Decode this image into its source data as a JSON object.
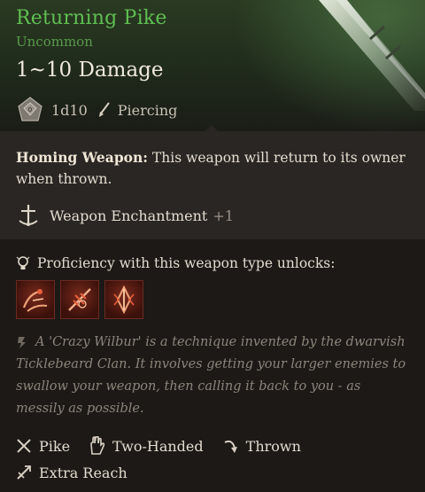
{
  "item": {
    "name": "Returning Pike",
    "rarity": "Uncommon",
    "damage": "1~10 Damage",
    "dice": "1d10",
    "damage_type": "Piercing"
  },
  "homing": {
    "title": "Homing Weapon:",
    "text": " This weapon will return to its owner when thrown."
  },
  "enchantment": {
    "label": "Weapon Enchantment",
    "value": "+1"
  },
  "proficiency": {
    "label": "Proficiency with this weapon type unlocks:",
    "actions": [
      "flourish-action-icon",
      "lacerate-action-icon",
      "pommel-strike-action-icon"
    ]
  },
  "lore": {
    "text": "A 'Crazy Wilbur' is a technique invented by the dwarvish Ticklebeard Clan. It involves getting your larger enemies to swallow your weapon, then calling it back to you - as messily as possible."
  },
  "tags": {
    "pike": "Pike",
    "two_handed": "Two-Handed",
    "thrown": "Thrown",
    "reach": "Extra Reach"
  },
  "colors": {
    "name": "#5fbf52",
    "rarity": "#5a9a4c",
    "action_bg": "#7a2a1c"
  }
}
